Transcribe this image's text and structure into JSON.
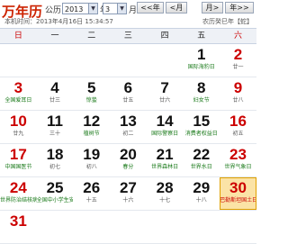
{
  "header": {
    "logo": "万年历",
    "calendar_label": "公历",
    "year_value": "2013",
    "year_suffix": "年",
    "month_value": "3",
    "month_suffix": "月",
    "prev_year": "<<年",
    "prev_month": "<月",
    "next_month": "月>",
    "next_year": "年>>",
    "today_text": "本机时间：2013年4月16日 15:34:57",
    "lunar_info": "农历癸巳年【蛇】"
  },
  "weekdays": [
    "日",
    "一",
    "二",
    "三",
    "四",
    "五",
    "六"
  ],
  "weeks": [
    [
      {
        "day": "",
        "sub": ""
      },
      {
        "day": "",
        "sub": ""
      },
      {
        "day": "",
        "sub": ""
      },
      {
        "day": "",
        "sub": ""
      },
      {
        "day": "",
        "sub": ""
      },
      {
        "day": "1",
        "sub": "国际海豹日"
      },
      {
        "day": "2",
        "sub": "廿一"
      }
    ],
    [
      {
        "day": "3",
        "sub": "全国爱耳日"
      },
      {
        "day": "4",
        "sub": "廿三"
      },
      {
        "day": "5",
        "sub": "惊蛰"
      },
      {
        "day": "6",
        "sub": "廿五"
      },
      {
        "day": "7",
        "sub": "廿六"
      },
      {
        "day": "8",
        "sub": "妇女节"
      },
      {
        "day": "9",
        "sub": "廿八"
      }
    ],
    [
      {
        "day": "10",
        "sub": "廿九"
      },
      {
        "day": "11",
        "sub": "三十"
      },
      {
        "day": "12",
        "sub": "植树节"
      },
      {
        "day": "13",
        "sub": "初二"
      },
      {
        "day": "14",
        "sub": "国际警察日"
      },
      {
        "day": "15",
        "sub": "消费者权益日"
      },
      {
        "day": "16",
        "sub": "初五"
      }
    ],
    [
      {
        "day": "17",
        "sub": "中国国医节"
      },
      {
        "day": "18",
        "sub": "初七"
      },
      {
        "day": "19",
        "sub": "初八"
      },
      {
        "day": "20",
        "sub": "春分"
      },
      {
        "day": "21",
        "sub": "世界森林日"
      },
      {
        "day": "22",
        "sub": "世界水日"
      },
      {
        "day": "23",
        "sub": "世界气象日"
      }
    ],
    [
      {
        "day": "24",
        "sub": "世界防治结核病日"
      },
      {
        "day": "25",
        "sub": "全国中小学生安全教育日"
      },
      {
        "day": "26",
        "sub": "十五"
      },
      {
        "day": "27",
        "sub": "十六"
      },
      {
        "day": "28",
        "sub": "十七"
      },
      {
        "day": "29",
        "sub": "十八"
      },
      {
        "day": "30",
        "sub": "巴勒斯坦国土日"
      }
    ],
    [
      {
        "day": "31",
        "sub": ""
      },
      {
        "day": "",
        "sub": ""
      },
      {
        "day": "",
        "sub": ""
      },
      {
        "day": "",
        "sub": ""
      },
      {
        "day": "",
        "sub": ""
      },
      {
        "day": "",
        "sub": ""
      },
      {
        "day": "",
        "sub": ""
      }
    ]
  ],
  "green_subs": [
    "国际海豹日",
    "全国爱耳日",
    "惊蛰",
    "妇女节",
    "植树节",
    "国际警察日",
    "消费者权益日",
    "中国国医节",
    "春分",
    "世界森林日",
    "世界水日",
    "世界气象日",
    "世界防治结核病日",
    "全国中小学生安全教育日",
    "巴勒斯坦国土日"
  ],
  "highlight_day": "30",
  "colors": {
    "weekend": "#cc0000",
    "festival": "#1a7a1a",
    "highlight_bg": "#fbe3a6",
    "logo": "#cc2200"
  }
}
